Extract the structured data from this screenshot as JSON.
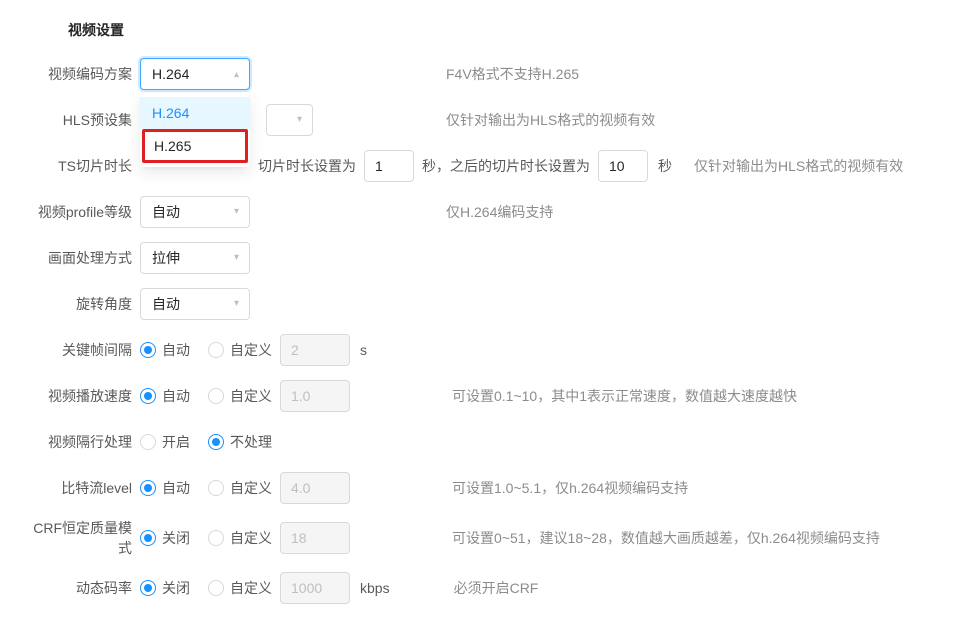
{
  "section_title": "视频设置",
  "rows": {
    "codec": {
      "label": "视频编码方案",
      "value": "H.264",
      "options": [
        "H.264",
        "H.265"
      ],
      "hint": "F4V格式不支持H.265"
    },
    "hls_preset": {
      "label": "HLS预设集",
      "value": "",
      "hint": "仅针对输出为HLS格式的视频有效"
    },
    "ts": {
      "label": "TS切片时长",
      "text_prefix": "切片时长设置为",
      "first_val": "1",
      "text_mid": "秒，之后的切片时长设置为",
      "second_val": "10",
      "unit": "秒",
      "hint": "仅针对输出为HLS格式的视频有效"
    },
    "profile": {
      "label": "视频profile等级",
      "value": "自动",
      "hint": "仅H.264编码支持"
    },
    "scale": {
      "label": "画面处理方式",
      "value": "拉伸"
    },
    "rotate": {
      "label": "旋转角度",
      "value": "自动"
    },
    "keyframe": {
      "label": "关键帧间隔",
      "radio_auto": "自动",
      "radio_custom": "自定义",
      "custom_val": "2",
      "unit": "s"
    },
    "speed": {
      "label": "视频播放速度",
      "radio_auto": "自动",
      "radio_custom": "自定义",
      "custom_val": "1.0",
      "hint": "可设置0.1~10，其中1表示正常速度，数值越大速度越快"
    },
    "deinterlace": {
      "label": "视频隔行处理",
      "radio_on": "开启",
      "radio_off": "不处理"
    },
    "bitlevel": {
      "label": "比特流level",
      "radio_auto": "自动",
      "radio_custom": "自定义",
      "custom_val": "4.0",
      "hint": "可设置1.0~5.1，仅h.264视频编码支持"
    },
    "crf": {
      "label": "CRF恒定质量模式",
      "radio_off": "关闭",
      "radio_custom": "自定义",
      "custom_val": "18",
      "hint": "可设置0~51，建议18~28，数值越大画质越差，仅h.264视频编码支持"
    },
    "dynbitrate": {
      "label": "动态码率",
      "radio_off": "关闭",
      "radio_custom": "自定义",
      "custom_val": "1000",
      "unit": "kbps",
      "hint": "必须开启CRF"
    }
  }
}
